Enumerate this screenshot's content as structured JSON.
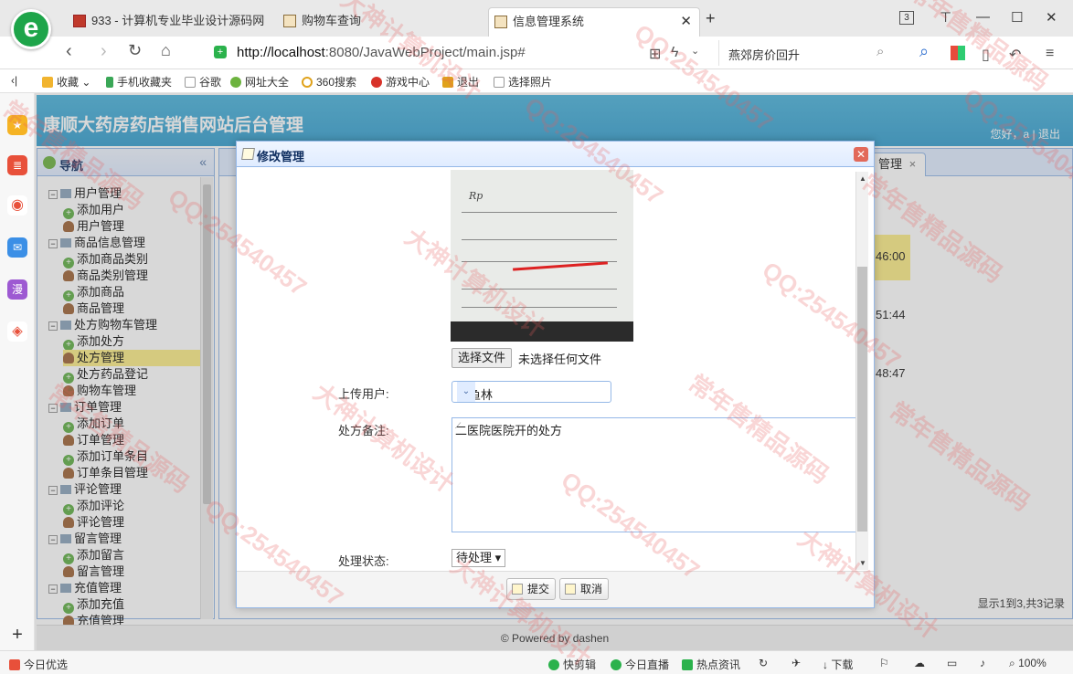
{
  "browser": {
    "tabs": [
      {
        "label": "933 - 计算机专业毕业设计源码网"
      },
      {
        "label": "购物车查询"
      },
      {
        "label": "信息管理系统"
      }
    ],
    "tab_count": "3",
    "url_host": "http://localhost",
    "url_rest": ":8080/JavaWebProject/main.jsp#",
    "search_text": "燕郊房价回升",
    "bookmarks": [
      "收藏",
      "手机收藏夹",
      "谷歌",
      "网址大全",
      "360搜索",
      "游戏中心",
      "退出",
      "选择照片"
    ]
  },
  "app": {
    "title": "康顺大药房药店销售网站后台管理",
    "welcome": "您好，a | 退出",
    "nav_title": "导航",
    "tree": [
      {
        "label": "用户管理",
        "level": 0
      },
      {
        "label": "添加用户",
        "level": 1,
        "type": "add"
      },
      {
        "label": "用户管理",
        "level": 1,
        "type": "user"
      },
      {
        "label": "商品信息管理",
        "level": 0
      },
      {
        "label": "添加商品类别",
        "level": 1,
        "type": "add"
      },
      {
        "label": "商品类别管理",
        "level": 1,
        "type": "user"
      },
      {
        "label": "添加商品",
        "level": 1,
        "type": "add"
      },
      {
        "label": "商品管理",
        "level": 1,
        "type": "user"
      },
      {
        "label": "处方购物车管理",
        "level": 0
      },
      {
        "label": "添加处方",
        "level": 1,
        "type": "add"
      },
      {
        "label": "处方管理",
        "level": 1,
        "type": "user",
        "selected": true
      },
      {
        "label": "处方药品登记",
        "level": 1,
        "type": "add"
      },
      {
        "label": "购物车管理",
        "level": 1,
        "type": "user"
      },
      {
        "label": "订单管理",
        "level": 0
      },
      {
        "label": "添加订单",
        "level": 1,
        "type": "add"
      },
      {
        "label": "订单管理",
        "level": 1,
        "type": "user"
      },
      {
        "label": "添加订单条目",
        "level": 1,
        "type": "add"
      },
      {
        "label": "订单条目管理",
        "level": 1,
        "type": "user"
      },
      {
        "label": "评论管理",
        "level": 0
      },
      {
        "label": "添加评论",
        "level": 1,
        "type": "add"
      },
      {
        "label": "评论管理",
        "level": 1,
        "type": "user"
      },
      {
        "label": "留言管理",
        "level": 0
      },
      {
        "label": "添加留言",
        "level": 1,
        "type": "add"
      },
      {
        "label": "留言管理",
        "level": 1,
        "type": "user"
      },
      {
        "label": "充值管理",
        "level": 0
      },
      {
        "label": "添加充值",
        "level": 1,
        "type": "add"
      },
      {
        "label": "充值管理",
        "level": 1,
        "type": "user"
      }
    ],
    "content_tab": "管理",
    "grid_times": [
      "46:00",
      "51:44",
      "48:47"
    ],
    "pager": "显示1到3,共3记录",
    "footer": "© Powered by dashen"
  },
  "dialog": {
    "title": "修改管理",
    "file_button": "选择文件",
    "file_status": "未选择任何文件",
    "upload_user_label": "上传用户:",
    "upload_user_value": "双鱼林",
    "note_label": "处方备注:",
    "note_value": "二医院医院开的处方",
    "status_label": "处理状态:",
    "status_value": "待处理",
    "submit_label": "提交",
    "cancel_label": "取消"
  },
  "statusbar": {
    "left": "今日优选",
    "items": [
      "快剪辑",
      "今日直播",
      "热点资讯",
      "下载"
    ],
    "zoom": "100%"
  },
  "watermarks": [
    "大神计算机设计",
    "QQ:254540457",
    "常年售精品源码"
  ],
  "colors": {
    "banner": "#3aa0cf",
    "panel_border": "#95b8e7",
    "selected_row": "#fbec88",
    "watermark": "#e65a5a"
  }
}
